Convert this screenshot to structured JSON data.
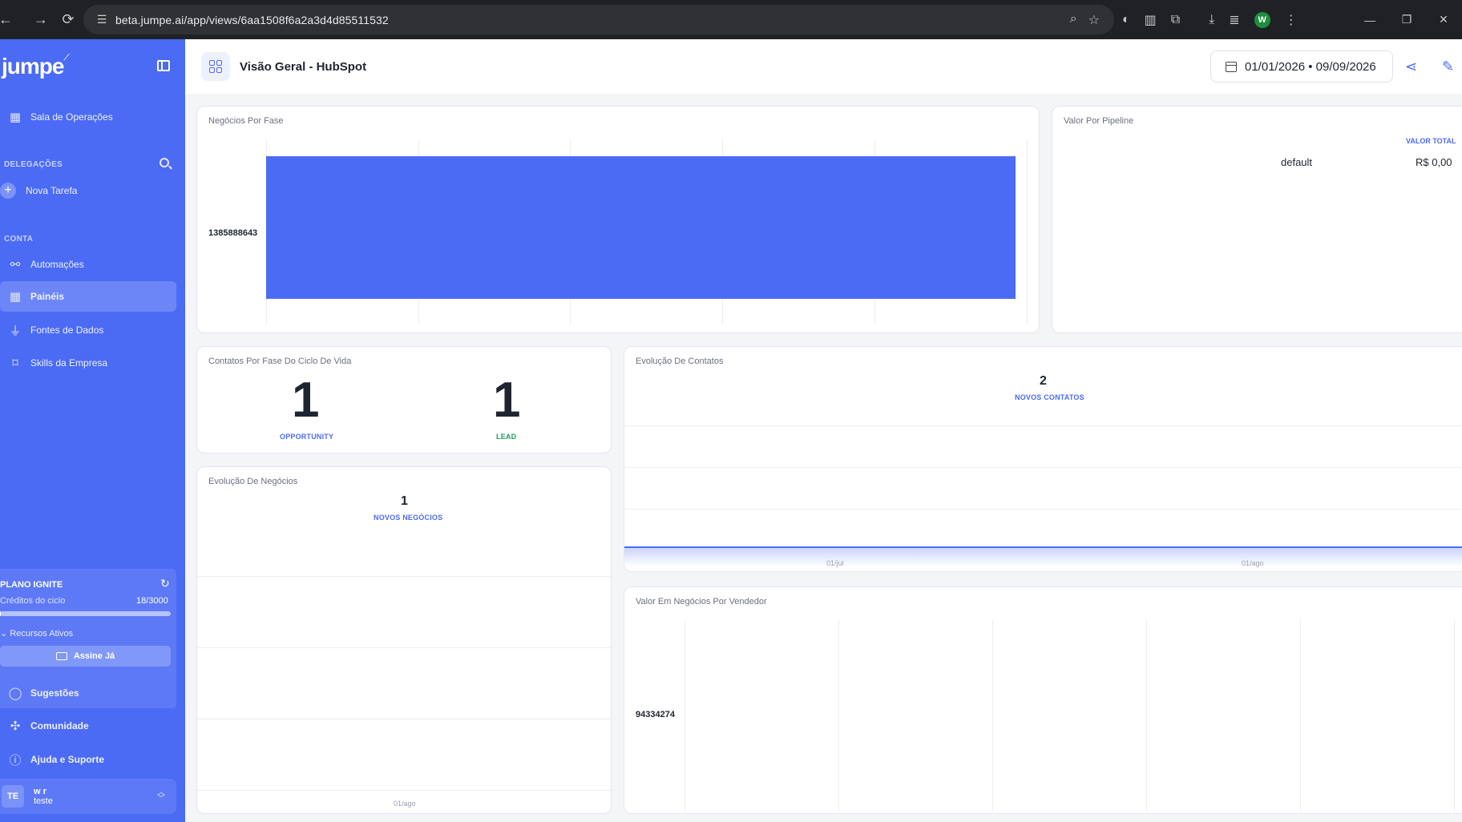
{
  "browser": {
    "url": "beta.jumpe.ai/app/views/6aa1508f6a2a3d4d85511532",
    "profile_initial": "W"
  },
  "sidebar": {
    "logo": "jumpe",
    "items_top": [
      {
        "label": "Sala de Operações",
        "icon": "grid-icon"
      }
    ],
    "section_delegacoes": "DELEGAÇÕES",
    "new_task": "Nova Tarefa",
    "section_conta": "CONTA",
    "items_conta": [
      {
        "label": "Automações",
        "icon": "automation-icon"
      },
      {
        "label": "Painéis",
        "icon": "dashboard-icon",
        "active": true
      },
      {
        "label": "Fontes de Dados",
        "icon": "plug-icon"
      },
      {
        "label": "Skills da Empresa",
        "icon": "bookmark-icon"
      }
    ],
    "plan": {
      "title": "PLANO IGNITE",
      "credits_label": "Créditos do ciclo",
      "credits_value": "18/3000",
      "credits_fraction": 0.006,
      "resources": "Recursos Ativos",
      "cta": "Assine Já"
    },
    "items_bottom": [
      {
        "label": "Sugestões",
        "icon": "chat-icon"
      },
      {
        "label": "Comunidade",
        "icon": "slack-icon"
      },
      {
        "label": "Ajuda e Suporte",
        "icon": "help-icon"
      }
    ],
    "user": {
      "initials": "TE",
      "name": "w r",
      "org": "teste"
    }
  },
  "topbar": {
    "title": "Visão Geral - HubSpot",
    "date_range": "01/01/2026 • 09/09/2026"
  },
  "panels": {
    "negocios_por_fase": {
      "title": "Negócios Por Fase",
      "bar_label": "1385888643"
    },
    "valor_por_pipeline": {
      "title": "Valor Por Pipeline",
      "col_header": "VALOR TOTAL",
      "row_name": "default",
      "row_value": "R$ 0,00"
    },
    "contatos_ciclo": {
      "title": "Contatos Por Fase Do Ciclo De Vida",
      "kpis": [
        {
          "value": "1",
          "label": "OPPORTUNITY",
          "color": "#4b6bf5"
        },
        {
          "value": "1",
          "label": "LEAD",
          "color": "#1aa05b"
        }
      ]
    },
    "evolucao_contatos": {
      "title": "Evolução De Contatos",
      "value": "2",
      "label": "NOVOS CONTATOS",
      "ticks": [
        "01/jul",
        "01/ago"
      ]
    },
    "evolucao_negocios": {
      "title": "Evolução De Negócios",
      "value": "1",
      "label": "NOVOS NEGÓCIOS",
      "ticks": [
        "01/ago"
      ]
    },
    "valor_vendedor": {
      "title": "Valor Em Negócios Por Vendedor",
      "bar_label": "94334274"
    }
  }
}
